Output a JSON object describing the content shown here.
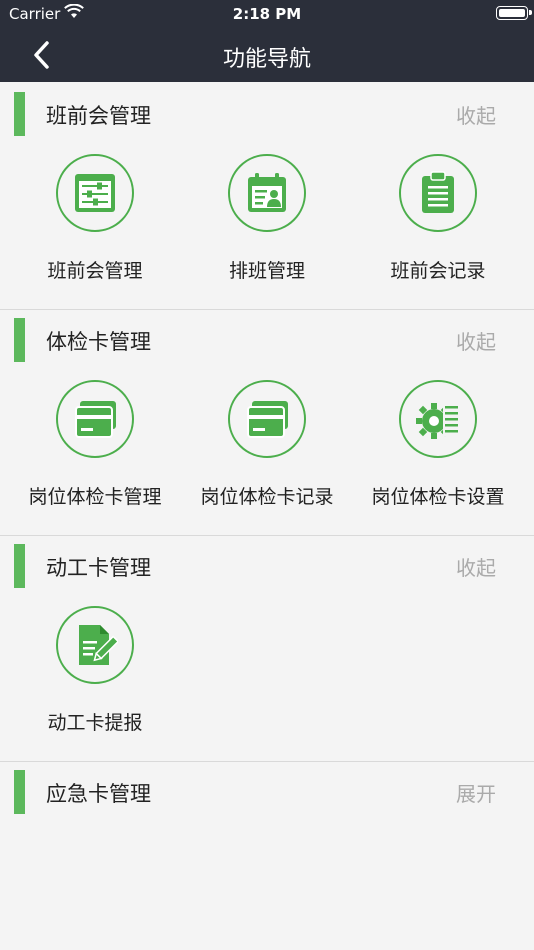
{
  "status": {
    "carrier": "Carrier",
    "time": "2:18 PM"
  },
  "nav": {
    "title": "功能导航",
    "back_icon": "chevron-left-icon"
  },
  "colors": {
    "nav_bg": "#2b2f3a",
    "accent": "#5cb85c",
    "icon_green": "#4cae4c",
    "page_bg": "#f4f4f4"
  },
  "sections": [
    {
      "title": "班前会管理",
      "toggle": "收起",
      "items": [
        {
          "label": "班前会管理",
          "icon": "sliders-icon"
        },
        {
          "label": "排班管理",
          "icon": "calendar-user-icon"
        },
        {
          "label": "班前会记录",
          "icon": "clipboard-icon"
        }
      ]
    },
    {
      "title": "体检卡管理",
      "toggle": "收起",
      "items": [
        {
          "label": "岗位体检卡管理",
          "icon": "card-icon"
        },
        {
          "label": "岗位体检卡记录",
          "icon": "card-icon"
        },
        {
          "label": "岗位体检卡设置",
          "icon": "gear-list-icon"
        }
      ]
    },
    {
      "title": "动工卡管理",
      "toggle": "收起",
      "items": [
        {
          "label": "动工卡提报",
          "icon": "document-edit-icon"
        }
      ]
    },
    {
      "title": "应急卡管理",
      "toggle": "展开",
      "items": []
    }
  ]
}
